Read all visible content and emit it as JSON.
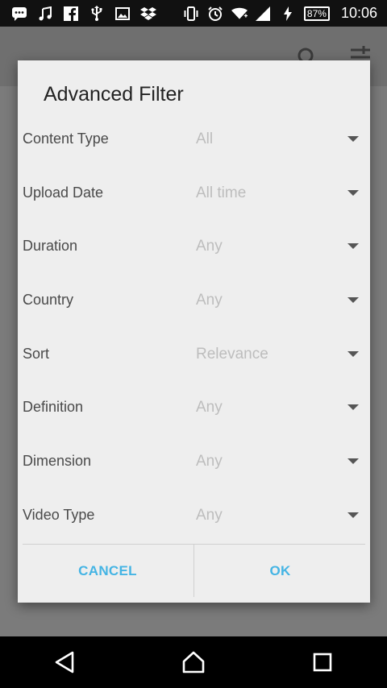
{
  "status_bar": {
    "battery": "87%",
    "time": "10:06",
    "left_icons": [
      "message-icon",
      "music-icon",
      "facebook-icon",
      "usb-icon",
      "image-icon",
      "dropbox-icon"
    ],
    "right_icons": [
      "vibrate-icon",
      "alarm-icon",
      "wifi-icon",
      "signal-icon",
      "charging-icon"
    ]
  },
  "dialog": {
    "title": "Advanced Filter",
    "rows": [
      {
        "label": "Content Type",
        "value": "All"
      },
      {
        "label": "Upload Date",
        "value": "All time"
      },
      {
        "label": "Duration",
        "value": "Any"
      },
      {
        "label": "Country",
        "value": "Any"
      },
      {
        "label": "Sort",
        "value": "Relevance"
      },
      {
        "label": "Definition",
        "value": "Any"
      },
      {
        "label": "Dimension",
        "value": "Any"
      },
      {
        "label": "Video Type",
        "value": "Any"
      }
    ],
    "cancel_label": "CANCEL",
    "ok_label": "OK"
  },
  "colors": {
    "accent": "#44b4e4",
    "dialog_bg": "#eeeeee",
    "scrim": "#7b7b7b"
  }
}
